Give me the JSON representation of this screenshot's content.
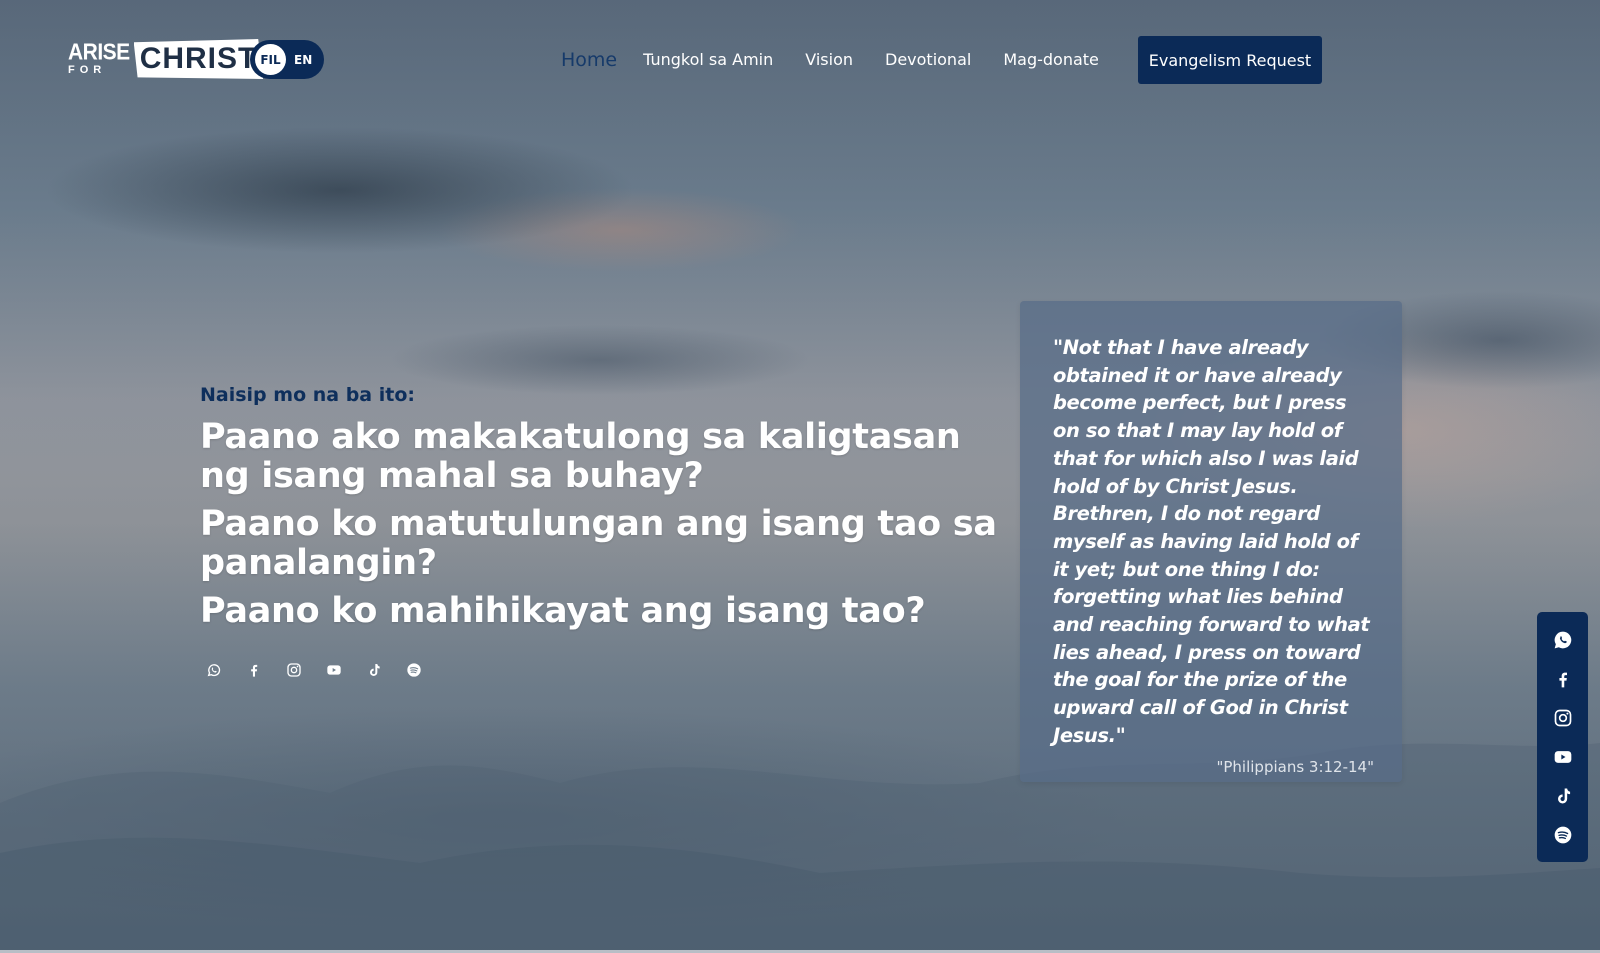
{
  "header": {
    "logo": {
      "arise": "ARISE",
      "for": "FOR",
      "christ": "CHRIST"
    },
    "language": {
      "primary": "FIL",
      "secondary": "EN"
    },
    "nav": [
      {
        "label": "Home",
        "active": true
      },
      {
        "label": "Tungkol sa Amin"
      },
      {
        "label": "Vision"
      },
      {
        "label": "Devotional"
      },
      {
        "label": "Mag-donate"
      }
    ],
    "cta_label": "Evangelism Request"
  },
  "hero": {
    "kicker": "Naisip mo na ba ito:",
    "questions": [
      "Paano ako makakatulong sa kaligtasan ng isang mahal sa buhay?",
      "Paano ko matutulungan ang isang tao sa panalangin?",
      "Paano ko mahihikayat ang isang tao?"
    ],
    "social_icons": [
      "whatsapp-icon",
      "facebook-icon",
      "instagram-icon",
      "youtube-icon",
      "tiktok-icon",
      "spotify-icon"
    ]
  },
  "quote": {
    "text": "\"Not that I have already obtained it or have already become perfect, but I press on so that I may lay hold of that for which also I was laid hold of by Christ Jesus. Brethren, I do not regard myself as having laid hold of it yet; but one thing I do: forgetting what lies behind and reaching forward to what lies ahead, I press on toward the goal for the prize of the upward call of God in Christ Jesus.\"",
    "reference": "\"Philippians 3:12-14\""
  },
  "social_rail": {
    "icons": [
      "whatsapp-icon",
      "facebook-icon",
      "instagram-icon",
      "youtube-icon",
      "tiktok-icon",
      "spotify-icon"
    ]
  },
  "colors": {
    "navy": "#0b2a57",
    "active_link": "#163a6a",
    "kicker": "#0e2f5c",
    "card": "#586c88"
  }
}
